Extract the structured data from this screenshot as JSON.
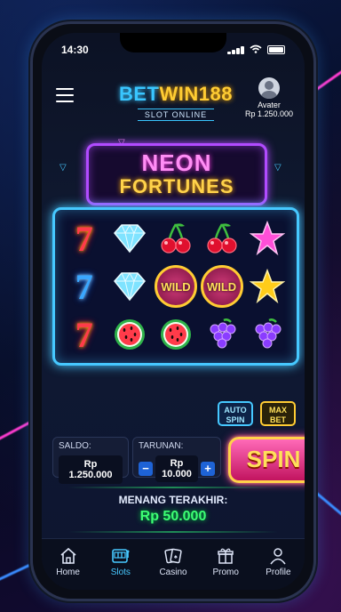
{
  "status_bar": {
    "time": "14:30"
  },
  "header": {
    "brand_part1": "BET",
    "brand_part2": "WIN188",
    "brand_sub": "SLOT ONLINE",
    "user_name": "Avater",
    "user_balance": "Rp 1.250.000"
  },
  "game": {
    "title_line1": "NEON",
    "title_line2": "FORTUNES",
    "reels": [
      [
        "seven-red",
        "diamond",
        "cherry",
        "cherry",
        "star-pink"
      ],
      [
        "seven-blue",
        "diamond",
        "WILD",
        "WILD",
        "star-gold"
      ],
      [
        "seven-red",
        "watermelon",
        "watermelon",
        "grapes",
        "grapes"
      ]
    ]
  },
  "controls": {
    "auto_label": "AUTO SPIN",
    "max_label": "MAX BET",
    "saldo_label": "SALDO:",
    "saldo_value": "Rp 1.250.000",
    "taruhan_label": "TARUNAN:",
    "taruhan_value": "Rp 10.000",
    "minus": "−",
    "plus": "+",
    "spin_label": "SPIN"
  },
  "last_win": {
    "label": "MENANG TERAKHIR:",
    "value": "Rp 50.000"
  },
  "nav": [
    {
      "label": "Home",
      "icon": "home-icon"
    },
    {
      "label": "Slots",
      "icon": "slot-machine-icon",
      "active": true
    },
    {
      "label": "Casino",
      "icon": "cards-icon"
    },
    {
      "label": "Promo",
      "icon": "gift-icon"
    },
    {
      "label": "Profile",
      "icon": "user-icon"
    }
  ],
  "colors": {
    "accent": "#46c8ff",
    "gold": "#ffcc33",
    "pink": "#ff3ca8",
    "win": "#3dff74"
  }
}
